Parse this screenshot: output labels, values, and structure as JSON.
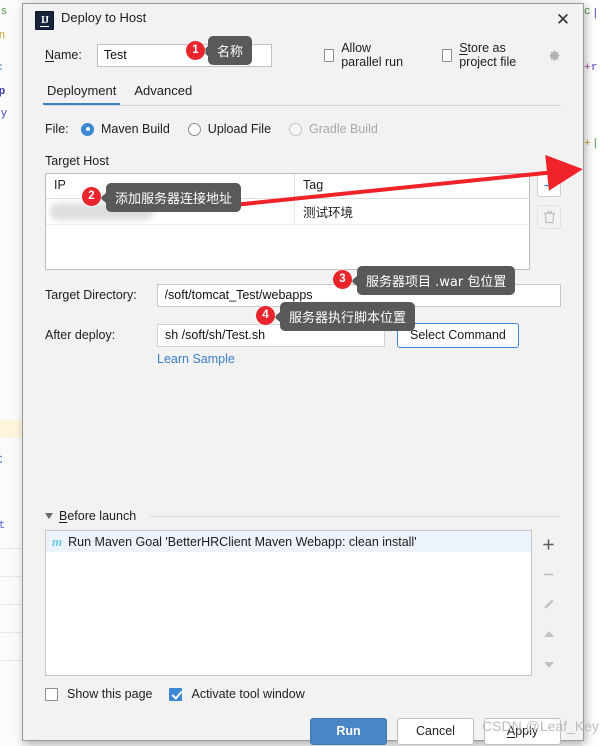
{
  "window": {
    "title": "Deploy to Host",
    "app_icon": "intellij-idea-icon",
    "close_icon": "close-icon"
  },
  "name_row": {
    "label": "Name:",
    "value": "Test",
    "placeholder": "",
    "allow_parallel_run": "Allow parallel run",
    "allow_parallel_run_checked": false,
    "store_as_project_file": "Store as project file",
    "store_as_project_file_checked": false,
    "gear_icon": "gear-icon"
  },
  "tabs": [
    {
      "label": "Deployment",
      "active": true
    },
    {
      "label": "Advanced",
      "active": false
    }
  ],
  "file_row": {
    "label": "File:",
    "options": [
      {
        "label": "Maven Build",
        "selected": true,
        "disabled": false
      },
      {
        "label": "Upload File",
        "selected": false,
        "disabled": false
      },
      {
        "label": "Gradle Build",
        "selected": false,
        "disabled": true
      }
    ]
  },
  "target_host": {
    "section_label": "Target Host",
    "columns": [
      "IP",
      "Tag"
    ],
    "rows": [
      {
        "ip": "",
        "ip_masked": true,
        "tag": "测试环境"
      }
    ],
    "add_icon": "plus-icon",
    "delete_icon": "trash-icon"
  },
  "target_directory": {
    "label": "Target Directory:",
    "value": "/soft/tomcat_Test/webapps"
  },
  "after_deploy": {
    "label": "After deploy:",
    "value": "sh /soft/sh/Test.sh",
    "select_command_button": "Select Command",
    "learn_sample_link": "Learn Sample"
  },
  "before_launch": {
    "title": "Before launch",
    "expand_icon": "chevron-down-icon",
    "items": [
      {
        "icon": "maven-icon",
        "text": "Run Maven Goal 'BetterHRClient Maven Webapp: clean install'"
      }
    ],
    "tools": [
      {
        "icon": "plus-icon",
        "label": "+"
      },
      {
        "icon": "minus-icon",
        "label": "−"
      },
      {
        "icon": "pencil-icon",
        "label": "✎"
      },
      {
        "icon": "arrow-up-icon",
        "label": "▲"
      },
      {
        "icon": "arrow-down-icon",
        "label": "▼"
      }
    ]
  },
  "footer": {
    "show_this_page": "Show this page",
    "show_this_page_checked": false,
    "activate_tool_window": "Activate tool window",
    "activate_tool_window_checked": true,
    "buttons": [
      {
        "label": "Run",
        "primary": true
      },
      {
        "label": "Cancel",
        "primary": false
      },
      {
        "label": "Apply",
        "primary": false
      }
    ]
  },
  "annotations": [
    {
      "number": "1",
      "text": "名称"
    },
    {
      "number": "2",
      "text": "添加服务器连接地址"
    },
    {
      "number": "3",
      "text": "服务器项目 .war 包位置"
    },
    {
      "number": "4",
      "text": "服务器执行脚本位置"
    }
  ],
  "watermark": "CSDN @Leaf_Key",
  "colors": {
    "accent": "#3b87d6",
    "primary_button": "#4a86c5",
    "link": "#3b7fc4",
    "badge": "#e8242c",
    "callout": "#595959",
    "arrow": "#f0222a"
  }
}
